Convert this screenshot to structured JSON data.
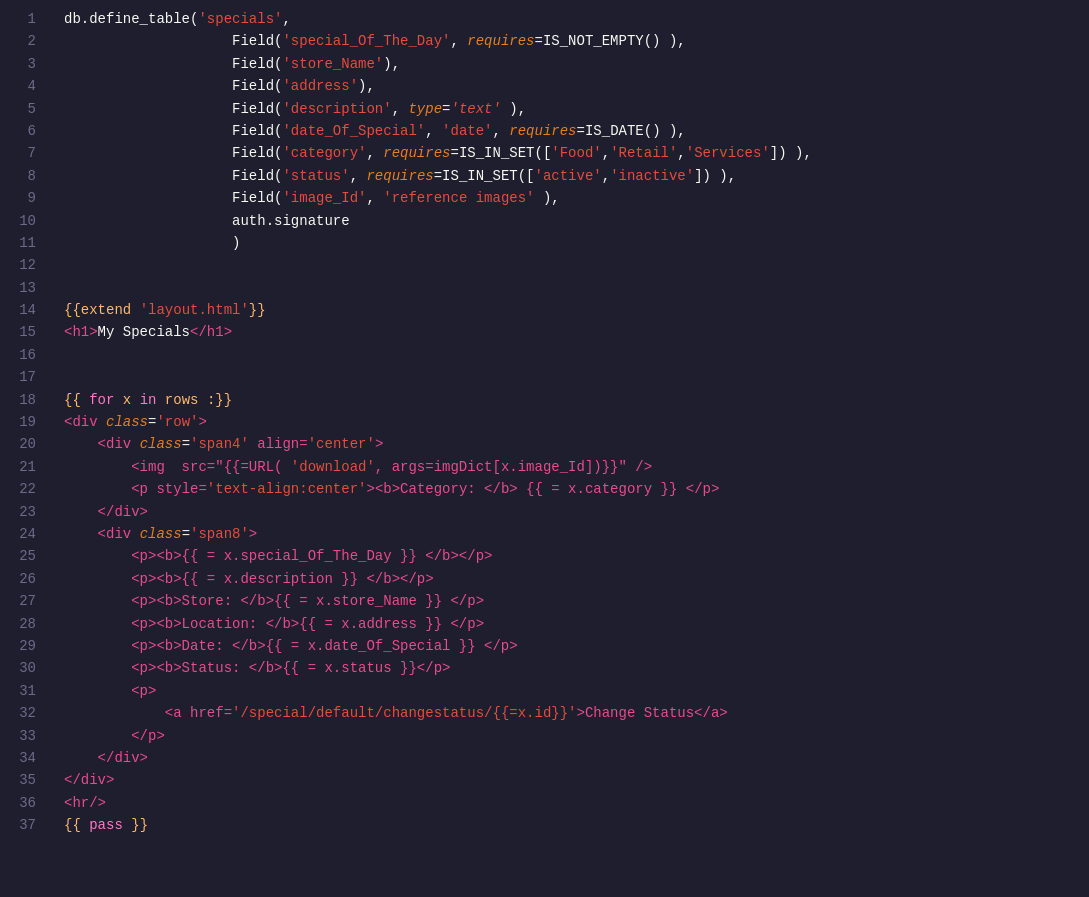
{
  "editor": {
    "background": "#1e1e2e",
    "lines": [
      {
        "num": 1,
        "tokens": [
          {
            "t": "db.define_table(",
            "c": "c-white"
          },
          {
            "t": "'specials'",
            "c": "c-string"
          },
          {
            "t": ",",
            "c": "c-white"
          }
        ]
      },
      {
        "num": 2,
        "tokens": [
          {
            "t": "                    Field(",
            "c": "c-white"
          },
          {
            "t": "'special_Of_The_Day'",
            "c": "c-string"
          },
          {
            "t": ", ",
            "c": "c-white"
          },
          {
            "t": "requires",
            "c": "c-italic-orange"
          },
          {
            "t": "=IS_NOT_EMPTY() ),",
            "c": "c-white"
          }
        ]
      },
      {
        "num": 3,
        "tokens": [
          {
            "t": "                    Field(",
            "c": "c-white"
          },
          {
            "t": "'store_Name'",
            "c": "c-string"
          },
          {
            "t": "),",
            "c": "c-white"
          }
        ]
      },
      {
        "num": 4,
        "tokens": [
          {
            "t": "                    Field(",
            "c": "c-white"
          },
          {
            "t": "'address'",
            "c": "c-string"
          },
          {
            "t": "),",
            "c": "c-white"
          }
        ]
      },
      {
        "num": 5,
        "tokens": [
          {
            "t": "                    Field(",
            "c": "c-white"
          },
          {
            "t": "'description'",
            "c": "c-string"
          },
          {
            "t": ", ",
            "c": "c-white"
          },
          {
            "t": "type",
            "c": "c-italic-orange"
          },
          {
            "t": "=",
            "c": "c-white"
          },
          {
            "t": "'text'",
            "c": "c-italic-red"
          },
          {
            "t": " ),",
            "c": "c-white"
          }
        ]
      },
      {
        "num": 6,
        "tokens": [
          {
            "t": "                    Field(",
            "c": "c-white"
          },
          {
            "t": "'date_Of_Special'",
            "c": "c-string"
          },
          {
            "t": ", ",
            "c": "c-white"
          },
          {
            "t": "'date'",
            "c": "c-string"
          },
          {
            "t": ", ",
            "c": "c-white"
          },
          {
            "t": "requires",
            "c": "c-italic-orange"
          },
          {
            "t": "=IS_DATE() ),",
            "c": "c-white"
          }
        ]
      },
      {
        "num": 7,
        "tokens": [
          {
            "t": "                    Field(",
            "c": "c-white"
          },
          {
            "t": "'category'",
            "c": "c-string"
          },
          {
            "t": ", ",
            "c": "c-white"
          },
          {
            "t": "requires",
            "c": "c-italic-orange"
          },
          {
            "t": "=IS_IN_SET([",
            "c": "c-white"
          },
          {
            "t": "'Food'",
            "c": "c-string"
          },
          {
            "t": ",",
            "c": "c-white"
          },
          {
            "t": "'Retail'",
            "c": "c-string"
          },
          {
            "t": ",",
            "c": "c-white"
          },
          {
            "t": "'Services'",
            "c": "c-string"
          },
          {
            "t": "]) ),",
            "c": "c-white"
          }
        ]
      },
      {
        "num": 8,
        "tokens": [
          {
            "t": "                    Field(",
            "c": "c-white"
          },
          {
            "t": "'status'",
            "c": "c-string"
          },
          {
            "t": ", ",
            "c": "c-white"
          },
          {
            "t": "requires",
            "c": "c-italic-orange"
          },
          {
            "t": "=IS_IN_SET([",
            "c": "c-white"
          },
          {
            "t": "'active'",
            "c": "c-string"
          },
          {
            "t": ",",
            "c": "c-white"
          },
          {
            "t": "'inactive'",
            "c": "c-string"
          },
          {
            "t": "]) ),",
            "c": "c-white"
          }
        ]
      },
      {
        "num": 9,
        "tokens": [
          {
            "t": "                    Field(",
            "c": "c-white"
          },
          {
            "t": "'image_Id'",
            "c": "c-string"
          },
          {
            "t": ", ",
            "c": "c-white"
          },
          {
            "t": "'reference images'",
            "c": "c-string"
          },
          {
            "t": " ),",
            "c": "c-white"
          }
        ]
      },
      {
        "num": 10,
        "tokens": [
          {
            "t": "                    auth.signature",
            "c": "c-white"
          }
        ]
      },
      {
        "num": 11,
        "tokens": [
          {
            "t": "                    )",
            "c": "c-white"
          }
        ]
      },
      {
        "num": 12,
        "tokens": []
      },
      {
        "num": 13,
        "tokens": []
      },
      {
        "num": 14,
        "tokens": [
          {
            "t": "{{extend ",
            "c": "c-tpl"
          },
          {
            "t": "'layout.html'",
            "c": "c-string"
          },
          {
            "t": "}}",
            "c": "c-tpl"
          }
        ]
      },
      {
        "num": 15,
        "tokens": [
          {
            "t": "<h1>",
            "c": "c-tag"
          },
          {
            "t": "My Specials",
            "c": "c-white"
          },
          {
            "t": "</h1>",
            "c": "c-tag"
          }
        ]
      },
      {
        "num": 16,
        "tokens": []
      },
      {
        "num": 17,
        "tokens": []
      },
      {
        "num": 18,
        "tokens": [
          {
            "t": "{{ ",
            "c": "c-tpl"
          },
          {
            "t": "for",
            "c": "c-tpl-kw"
          },
          {
            "t": " x ",
            "c": "c-tpl"
          },
          {
            "t": "in",
            "c": "c-tpl-kw"
          },
          {
            "t": " rows :}}",
            "c": "c-tpl"
          }
        ]
      },
      {
        "num": 19,
        "tokens": [
          {
            "t": "<div ",
            "c": "c-tag"
          },
          {
            "t": "class",
            "c": "c-attr2"
          },
          {
            "t": "=",
            "c": "c-white"
          },
          {
            "t": "'row'",
            "c": "c-string"
          },
          {
            "t": ">",
            "c": "c-tag"
          }
        ]
      },
      {
        "num": 20,
        "tokens": [
          {
            "t": "    <div ",
            "c": "c-tag"
          },
          {
            "t": "class",
            "c": "c-attr2"
          },
          {
            "t": "=",
            "c": "c-white"
          },
          {
            "t": "'span4'",
            "c": "c-string"
          },
          {
            "t": " align=",
            "c": "c-tag"
          },
          {
            "t": "'center'",
            "c": "c-string"
          },
          {
            "t": ">",
            "c": "c-tag"
          }
        ]
      },
      {
        "num": 21,
        "tokens": [
          {
            "t": "        <img  src=\"{{=URL( ",
            "c": "c-tag"
          },
          {
            "t": "'download'",
            "c": "c-string"
          },
          {
            "t": ", args=imgDict[x.image_Id])}}\" />",
            "c": "c-tag"
          }
        ]
      },
      {
        "num": 22,
        "tokens": [
          {
            "t": "        <p ",
            "c": "c-tag"
          },
          {
            "t": "style=",
            "c": "c-tag"
          },
          {
            "t": "'text-align:center'",
            "c": "c-string"
          },
          {
            "t": "><b>Category: </b> {{ = x.category }} </p>",
            "c": "c-tag"
          }
        ]
      },
      {
        "num": 23,
        "tokens": [
          {
            "t": "    </div>",
            "c": "c-tag"
          }
        ]
      },
      {
        "num": 24,
        "tokens": [
          {
            "t": "    <div ",
            "c": "c-tag"
          },
          {
            "t": "class",
            "c": "c-attr2"
          },
          {
            "t": "=",
            "c": "c-white"
          },
          {
            "t": "'span8'",
            "c": "c-string"
          },
          {
            "t": ">",
            "c": "c-tag"
          }
        ]
      },
      {
        "num": 25,
        "tokens": [
          {
            "t": "        <p><b>{{ = x.special_Of_The_Day }} </b></p>",
            "c": "c-tag"
          }
        ]
      },
      {
        "num": 26,
        "tokens": [
          {
            "t": "        <p><b>{{ = x.description }} </b></p>",
            "c": "c-tag"
          }
        ]
      },
      {
        "num": 27,
        "tokens": [
          {
            "t": "        <p><b>Store: </b>{{ = x.store_Name }} </p>",
            "c": "c-tag"
          }
        ]
      },
      {
        "num": 28,
        "tokens": [
          {
            "t": "        <p><b>Location: </b>{{ = x.address }} </p>",
            "c": "c-tag"
          }
        ]
      },
      {
        "num": 29,
        "tokens": [
          {
            "t": "        <p><b>Date: </b>{{ = x.date_Of_Special }} </p>",
            "c": "c-tag"
          }
        ]
      },
      {
        "num": 30,
        "tokens": [
          {
            "t": "        <p><b>Status: </b>{{ = x.status }}</p>",
            "c": "c-tag"
          }
        ]
      },
      {
        "num": 31,
        "tokens": [
          {
            "t": "        <p>",
            "c": "c-tag"
          }
        ]
      },
      {
        "num": 32,
        "tokens": [
          {
            "t": "            <a href=",
            "c": "c-tag"
          },
          {
            "t": "'/special/default/changestatus/{{=x.id}}'",
            "c": "c-string"
          },
          {
            "t": ">Change Status</a>",
            "c": "c-tag"
          }
        ]
      },
      {
        "num": 33,
        "tokens": [
          {
            "t": "        </p>",
            "c": "c-tag"
          }
        ]
      },
      {
        "num": 34,
        "tokens": [
          {
            "t": "    </div>",
            "c": "c-tag"
          }
        ]
      },
      {
        "num": 35,
        "tokens": [
          {
            "t": "</div>",
            "c": "c-tag"
          }
        ]
      },
      {
        "num": 36,
        "tokens": [
          {
            "t": "<hr/>",
            "c": "c-tag"
          }
        ]
      },
      {
        "num": 37,
        "tokens": [
          {
            "t": "{{ ",
            "c": "c-tpl"
          },
          {
            "t": "pass",
            "c": "c-tpl-kw"
          },
          {
            "t": " }}",
            "c": "c-tpl"
          }
        ]
      }
    ]
  }
}
